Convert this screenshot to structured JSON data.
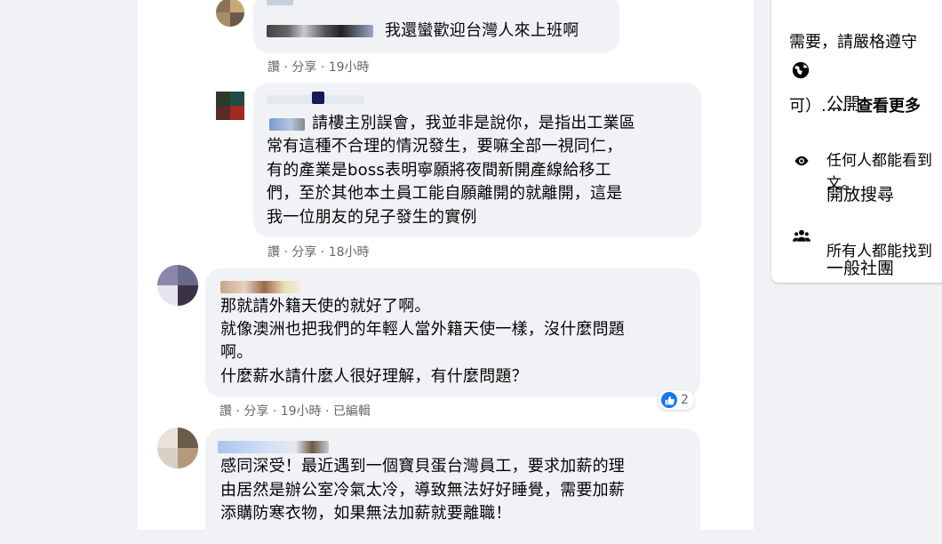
{
  "comments": [
    {
      "text": "我還蠻歡迎台灣人來上班啊",
      "meta": {
        "read": "讚",
        "share": "分享",
        "time": "19小時"
      }
    },
    {
      "lines": [
        "請樓主別誤會，我並非是說你，是指出工業區",
        "常有這種不合理的情況發生，要嘛全部一視同仁，",
        "有的產業是boss表明寧願將夜間新開產線給移工",
        "們，至於其他本土員工能自願離開的就離開，這是",
        "我一位朋友的兒子發生的實例"
      ],
      "meta": {
        "read": "讚",
        "share": "分享",
        "time": "18小時"
      }
    },
    {
      "lines": [
        "那就請外籍天使的就好了啊。",
        "就像澳洲也把我們的年輕人當外籍天使一樣，沒什麼問題",
        "啊。",
        "什麼薪水請什麼人很好理解，有什麼問題？"
      ],
      "meta": {
        "read": "讚",
        "share": "分享",
        "time": "19小時",
        "edited": "已編輯"
      },
      "reaction_count": "2"
    },
    {
      "lines": [
        "感同深受！最近遇到一個寶貝蛋台灣員工，要求加薪的理",
        "由居然是辦公室冷氣太冷，導致無法好好睡覺，需要加薪",
        "添購防寒衣物，如果無法加薪就要離職！"
      ]
    }
  ],
  "sidebar": {
    "top_line1": "需要，請嚴格遵守",
    "top_line2_prefix": "可）...... ",
    "see_more": "查看更多",
    "public_title": "公開",
    "public_desc": "任何人都能看到\n文。",
    "search_title": "開放搜尋",
    "search_desc": "所有人都能找到",
    "group_type": "一般社團"
  },
  "colors": {
    "background": "#f0f2f5",
    "bubble": "#f0f2f5",
    "meta_text": "#65676b",
    "like_blue": "#1877f2"
  },
  "icons": [
    "globe-icon",
    "eye-icon",
    "group-icon",
    "like-icon"
  ]
}
